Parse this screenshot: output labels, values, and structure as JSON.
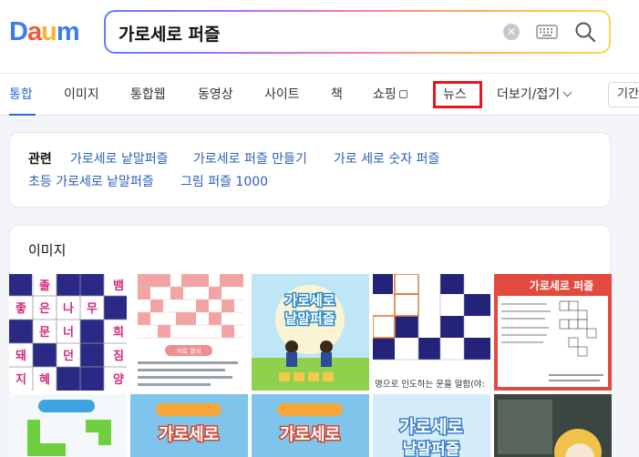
{
  "logo": {
    "letters": [
      "D",
      "a",
      "u",
      "m"
    ],
    "colors": [
      "#3b7cf4",
      "#f05a3a",
      "#f7b52c",
      "#3b7cf4"
    ]
  },
  "search": {
    "value": "가로세로 퍼즐",
    "clear_icon": "clear-icon",
    "keyboard_icon": "keyboard-icon",
    "search_icon": "search-icon"
  },
  "tabs": {
    "items": [
      "통합",
      "이미지",
      "통합웹",
      "동영상",
      "사이트",
      "책",
      "쇼핑",
      "뉴스",
      "더보기/접기"
    ],
    "active": "통합",
    "period": "기간"
  },
  "related": {
    "label": "관련",
    "links": [
      "가로세로 낱말퍼즐",
      "가로세로 퍼즐 만들기",
      "가로 세로 숫자 퍼즐",
      "초등 가로세로 낱말퍼즐",
      "그림 퍼즐 1000"
    ]
  },
  "images": {
    "title": "이미지",
    "thumb1_words": [
      "졸",
      "뱀",
      "좋",
      "은",
      "나",
      "무",
      "문",
      "너",
      "희",
      "돼",
      "던",
      "짐",
      "지",
      "혜",
      "양"
    ],
    "thumb2_caption": "가로 열쇠",
    "thumb3_title": [
      "가로세로",
      "낱말퍼즐"
    ],
    "thumb4_caption": "명으로 인도하는 운을 말함(야:",
    "thumb5_title": "가로세로 퍼즐",
    "row2_thumb2_title": "가로세로",
    "row2_thumb4_title": "가로세로",
    "row2_thumb4_sub": "낱말퍼즐"
  },
  "accent": "#2c68d8",
  "highlight": "#e4181e"
}
